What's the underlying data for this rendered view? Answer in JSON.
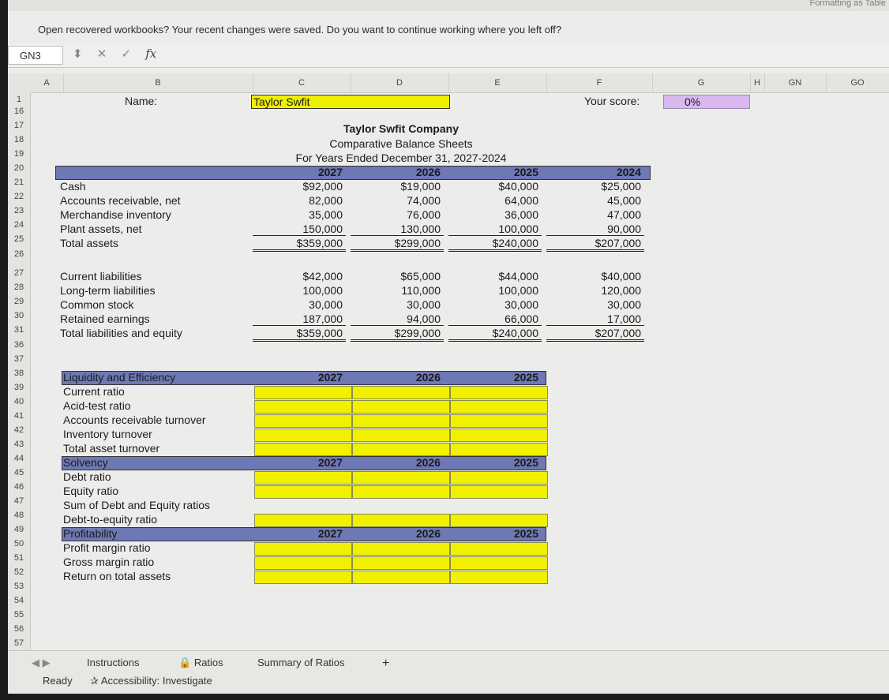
{
  "top_tag": "Formatting  as Table",
  "banner": "Open recovered workbooks? Your recent changes were saved. Do you want to continue working where you left off?",
  "name_box": "GN3",
  "fx_label": "fx",
  "columns": [
    "A",
    "B",
    "C",
    "D",
    "E",
    "F",
    "G",
    "H",
    "GN",
    "GO"
  ],
  "row_numbers": [
    "1",
    "16",
    "17",
    "18",
    "19",
    "20",
    "21",
    "22",
    "23",
    "24",
    "25",
    "26",
    "27",
    "28",
    "29",
    "30",
    "31",
    "36",
    "37",
    "38",
    "39",
    "40",
    "41",
    "42",
    "43",
    "44",
    "45",
    "46",
    "47",
    "48",
    "49",
    "50",
    "51",
    "52",
    "53",
    "54",
    "55",
    "56",
    "57"
  ],
  "row1": {
    "name_label": "Name:",
    "name_value": "Taylor Swfit",
    "score_label": "Your score:",
    "score_value": "0%"
  },
  "report": {
    "company": "Taylor Swfit Company",
    "title": "Comparative Balance Sheets",
    "period": "For Years Ended December 31, 2027-2024",
    "years": [
      "2027",
      "2026",
      "2025",
      "2024"
    ],
    "assets": [
      {
        "label": "Cash",
        "values": [
          "$92,000",
          "$19,000",
          "$40,000",
          "$25,000"
        ]
      },
      {
        "label": "Accounts receivable, net",
        "values": [
          "82,000",
          "74,000",
          "64,000",
          "45,000"
        ]
      },
      {
        "label": "Merchandise inventory",
        "values": [
          "35,000",
          "76,000",
          "36,000",
          "47,000"
        ]
      },
      {
        "label": "Plant assets, net",
        "values": [
          "150,000",
          "130,000",
          "100,000",
          "90,000"
        ]
      },
      {
        "label": "Total assets",
        "values": [
          "$359,000",
          "$299,000",
          "$240,000",
          "$207,000"
        ]
      }
    ],
    "liabilities": [
      {
        "label": "Current liabilities",
        "values": [
          "$42,000",
          "$65,000",
          "$44,000",
          "$40,000"
        ]
      },
      {
        "label": "Long-term liabilities",
        "values": [
          "100,000",
          "110,000",
          "100,000",
          "120,000"
        ]
      },
      {
        "label": "Common stock",
        "values": [
          "30,000",
          "30,000",
          "30,000",
          "30,000"
        ]
      },
      {
        "label": "Retained earnings",
        "values": [
          "187,000",
          "94,000",
          "66,000",
          "17,000"
        ]
      },
      {
        "label": "Total liabilities and equity",
        "values": [
          "$359,000",
          "$299,000",
          "$240,000",
          "$207,000"
        ]
      }
    ]
  },
  "ratios": {
    "years": [
      "2027",
      "2026",
      "2025"
    ],
    "liquidity": {
      "header": "Liquidity and Efficiency",
      "items": [
        "Current ratio",
        "Acid-test ratio",
        "Accounts receivable turnover",
        "Inventory turnover",
        "Total asset turnover"
      ]
    },
    "solvency": {
      "header": "Solvency",
      "items": [
        "Debt ratio",
        "Equity ratio",
        "Sum of Debt and Equity ratios",
        "Debt-to-equity ratio"
      ]
    },
    "profitability": {
      "header": "Profitability",
      "items": [
        "Profit margin ratio",
        "Gross margin ratio",
        "Return on total assets"
      ]
    }
  },
  "tabs": [
    "Instructions",
    "Ratios",
    "Summary of Ratios",
    "+"
  ],
  "status": {
    "ready": "Ready",
    "accessibility": "Accessibility: Investigate"
  }
}
